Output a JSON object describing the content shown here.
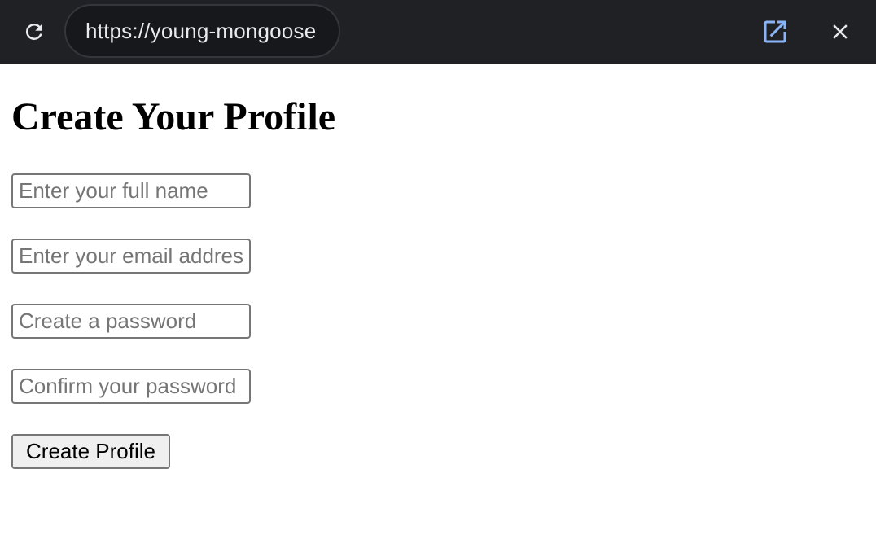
{
  "browser": {
    "url": "https://young-mongoose",
    "icons": {
      "reload": "reload-icon",
      "open_external": "open-external-icon",
      "close": "close-icon"
    },
    "accent_color": "#8ab4f8"
  },
  "page": {
    "title": "Create Your Profile",
    "fields": [
      {
        "placeholder": "Enter your full name",
        "value": ""
      },
      {
        "placeholder": "Enter your email address",
        "value": ""
      },
      {
        "placeholder": "Create a password",
        "value": ""
      },
      {
        "placeholder": "Confirm your password",
        "value": ""
      }
    ],
    "submit_label": "Create Profile"
  }
}
